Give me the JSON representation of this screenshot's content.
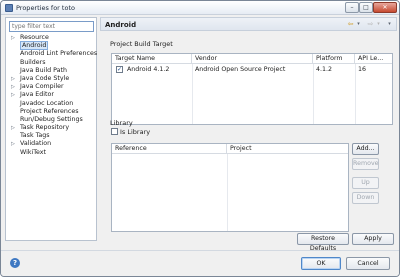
{
  "window": {
    "title": "Properties for toto"
  },
  "sidebar": {
    "filter_placeholder": "type filter text",
    "items": [
      {
        "label": "Resource",
        "expandable": true
      },
      {
        "label": "Android",
        "expandable": false,
        "selected": true
      },
      {
        "label": "Android Lint Preferences",
        "expandable": false
      },
      {
        "label": "Builders",
        "expandable": false
      },
      {
        "label": "Java Build Path",
        "expandable": false
      },
      {
        "label": "Java Code Style",
        "expandable": true
      },
      {
        "label": "Java Compiler",
        "expandable": true
      },
      {
        "label": "Java Editor",
        "expandable": true
      },
      {
        "label": "Javadoc Location",
        "expandable": false
      },
      {
        "label": "Project References",
        "expandable": false
      },
      {
        "label": "Run/Debug Settings",
        "expandable": false
      },
      {
        "label": "Task Repository",
        "expandable": true
      },
      {
        "label": "Task Tags",
        "expandable": false
      },
      {
        "label": "Validation",
        "expandable": true
      },
      {
        "label": "WikiText",
        "expandable": false
      }
    ]
  },
  "page": {
    "title": "Android"
  },
  "build_target": {
    "section_label": "Project Build Target",
    "columns": [
      "Target Name",
      "Vendor",
      "Platform",
      "API Le..."
    ],
    "rows": [
      {
        "checked": true,
        "name": "Android 4.1.2",
        "vendor": "Android Open Source Project",
        "platform": "4.1.2",
        "api": "16"
      }
    ]
  },
  "library": {
    "section_label": "Library",
    "is_library_label": "Is Library",
    "is_library_checked": false,
    "columns": [
      "Reference",
      "Project"
    ],
    "buttons": {
      "add": "Add...",
      "remove": "Remove",
      "up": "Up",
      "down": "Down"
    }
  },
  "actions": {
    "restore_defaults": "Restore Defaults",
    "apply": "Apply",
    "ok": "OK",
    "cancel": "Cancel"
  },
  "icons": {
    "help": "?",
    "back": "⇦",
    "forward": "⇨",
    "dropdown": "▾",
    "checkmark": "✓",
    "tree_arrow": "▷"
  }
}
